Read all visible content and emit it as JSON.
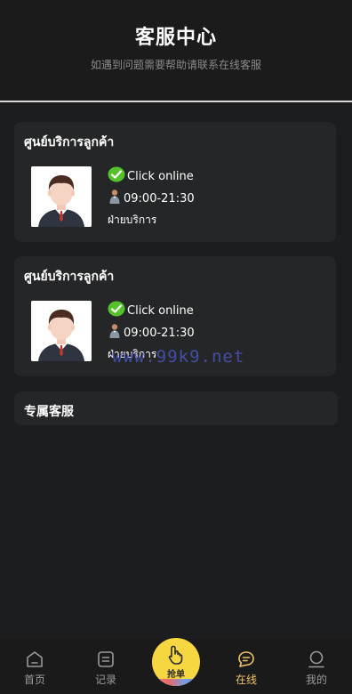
{
  "header": {
    "title": "客服中心",
    "subtitle": "如遇到问题需要帮助请联系在线客服"
  },
  "service_cards": [
    {
      "title": "ศูนย์บริการลูกค้า",
      "status": "Click online",
      "hours": "09:00-21:30",
      "department": "ฝ่ายบริการ",
      "status_icon": "check-badge-icon",
      "hours_icon": "person-icon"
    },
    {
      "title": "ศูนย์บริการลูกค้า",
      "status": "Click online",
      "hours": "09:00-21:30",
      "department": "ฝ่ายบริการ",
      "status_icon": "check-badge-icon",
      "hours_icon": "person-icon"
    }
  ],
  "exclusive": {
    "title": "专属客服"
  },
  "watermark": "www.99k9.net",
  "tabbar": {
    "home": "首页",
    "records": "记录",
    "grab": "抢单",
    "online": "在线",
    "mine": "我的"
  },
  "colors": {
    "background": "#1c1d1e",
    "card": "#252627",
    "accent_active": "#efc36b",
    "grab_button": "#f6d742",
    "check_green": "#55c22b",
    "watermark": "#4d57c9"
  }
}
